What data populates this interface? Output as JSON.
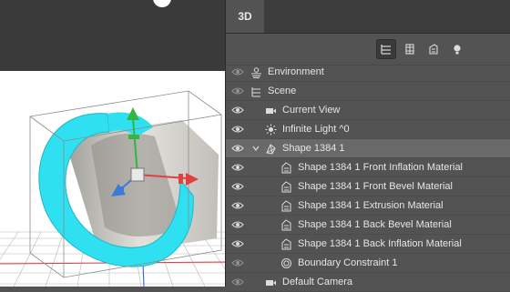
{
  "panel": {
    "tab_label": "3D"
  },
  "filters": [
    {
      "icon": "scene-filter-icon",
      "active": true
    },
    {
      "icon": "meshes-filter-icon",
      "active": false
    },
    {
      "icon": "materials-filter-icon",
      "active": false
    },
    {
      "icon": "lights-filter-icon",
      "active": false
    }
  ],
  "tree": [
    {
      "label": "Environment",
      "icon": "environment-icon",
      "visible": false
    },
    {
      "label": "Scene",
      "icon": "scene-icon",
      "visible": false
    },
    {
      "label": "Current View",
      "icon": "camera-icon",
      "visible": true
    },
    {
      "label": "Infinite Light ^0",
      "icon": "light-icon",
      "visible": true
    },
    {
      "label": "Shape 1384 1",
      "icon": "mesh-icon",
      "visible": true,
      "expanded": true,
      "selected": true
    },
    {
      "label": "Shape 1384 1 Front Inflation Material",
      "icon": "material-icon",
      "visible": true
    },
    {
      "label": "Shape 1384 1 Front Bevel Material",
      "icon": "material-icon",
      "visible": true
    },
    {
      "label": "Shape 1384 1 Extrusion Material",
      "icon": "material-icon",
      "visible": true
    },
    {
      "label": "Shape 1384 1 Back Bevel Material",
      "icon": "material-icon",
      "visible": true
    },
    {
      "label": "Shape 1384 1 Back Inflation Material",
      "icon": "material-icon",
      "visible": true
    },
    {
      "label": "Boundary Constraint 1",
      "icon": "constraint-icon",
      "visible": false
    },
    {
      "label": "Default Camera",
      "icon": "camera-icon",
      "visible": false
    }
  ],
  "colors": {
    "shape_face": "#2fe0f0",
    "x_axis": "#e04040",
    "y_axis": "#33b544",
    "z_axis": "#3a7bd5"
  }
}
